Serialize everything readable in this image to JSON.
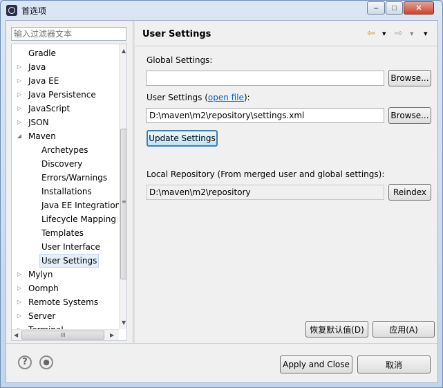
{
  "window": {
    "title": "首选项",
    "minimize": "–",
    "maximize": "□",
    "close": "✕"
  },
  "filter": {
    "placeholder": "输入过滤器文本"
  },
  "tree": [
    {
      "label": "Gradle",
      "depth": 1,
      "expander": ""
    },
    {
      "label": "Java",
      "depth": 1,
      "expander": "▷"
    },
    {
      "label": "Java EE",
      "depth": 1,
      "expander": "▷"
    },
    {
      "label": "Java Persistence",
      "depth": 1,
      "expander": "▷"
    },
    {
      "label": "JavaScript",
      "depth": 1,
      "expander": "▷"
    },
    {
      "label": "JSON",
      "depth": 1,
      "expander": "▷"
    },
    {
      "label": "Maven",
      "depth": 1,
      "expander": "◢"
    },
    {
      "label": "Archetypes",
      "depth": 2,
      "expander": ""
    },
    {
      "label": "Discovery",
      "depth": 2,
      "expander": ""
    },
    {
      "label": "Errors/Warnings",
      "depth": 2,
      "expander": ""
    },
    {
      "label": "Installations",
      "depth": 2,
      "expander": ""
    },
    {
      "label": "Java EE Integration",
      "depth": 2,
      "expander": ""
    },
    {
      "label": "Lifecycle Mapping",
      "depth": 2,
      "expander": ""
    },
    {
      "label": "Templates",
      "depth": 2,
      "expander": ""
    },
    {
      "label": "User Interface",
      "depth": 2,
      "expander": ""
    },
    {
      "label": "User Settings",
      "depth": 2,
      "expander": "",
      "selected": true
    },
    {
      "label": "Mylyn",
      "depth": 1,
      "expander": "▷"
    },
    {
      "label": "Oomph",
      "depth": 1,
      "expander": "▷"
    },
    {
      "label": "Remote Systems",
      "depth": 1,
      "expander": "▷"
    },
    {
      "label": "Server",
      "depth": 1,
      "expander": "▷"
    },
    {
      "label": "Terminal",
      "depth": 1,
      "expander": "▷"
    }
  ],
  "scroll": {
    "hthumb_grip": "III",
    "up": "▲",
    "down": "▼",
    "left": "◀",
    "right": "▶",
    "vgrip": "≡"
  },
  "page": {
    "title": "User Settings",
    "nav_back": "⇦",
    "nav_back_menu": "▾",
    "nav_forward": "⇨",
    "nav_forward_menu": "▾",
    "view_menu": "▾",
    "global_label": "Global Settings:",
    "global_value": "",
    "browse1": "Browse...",
    "user_label_prefix": "User Settings (",
    "user_label_link": "open file",
    "user_label_suffix": "):",
    "user_value": "D:\\maven\\m2\\repository\\settings.xml",
    "browse2": "Browse...",
    "update": "Update Settings",
    "local_label": "Local Repository (From merged user and global settings):",
    "local_value": "D:\\maven\\m2\\repository",
    "reindex": "Reindex",
    "restore": "恢复默认值(D)",
    "apply": "应用(A)"
  },
  "footer": {
    "help": "?",
    "record": "●",
    "apply_close": "Apply and Close",
    "cancel": "取消"
  }
}
